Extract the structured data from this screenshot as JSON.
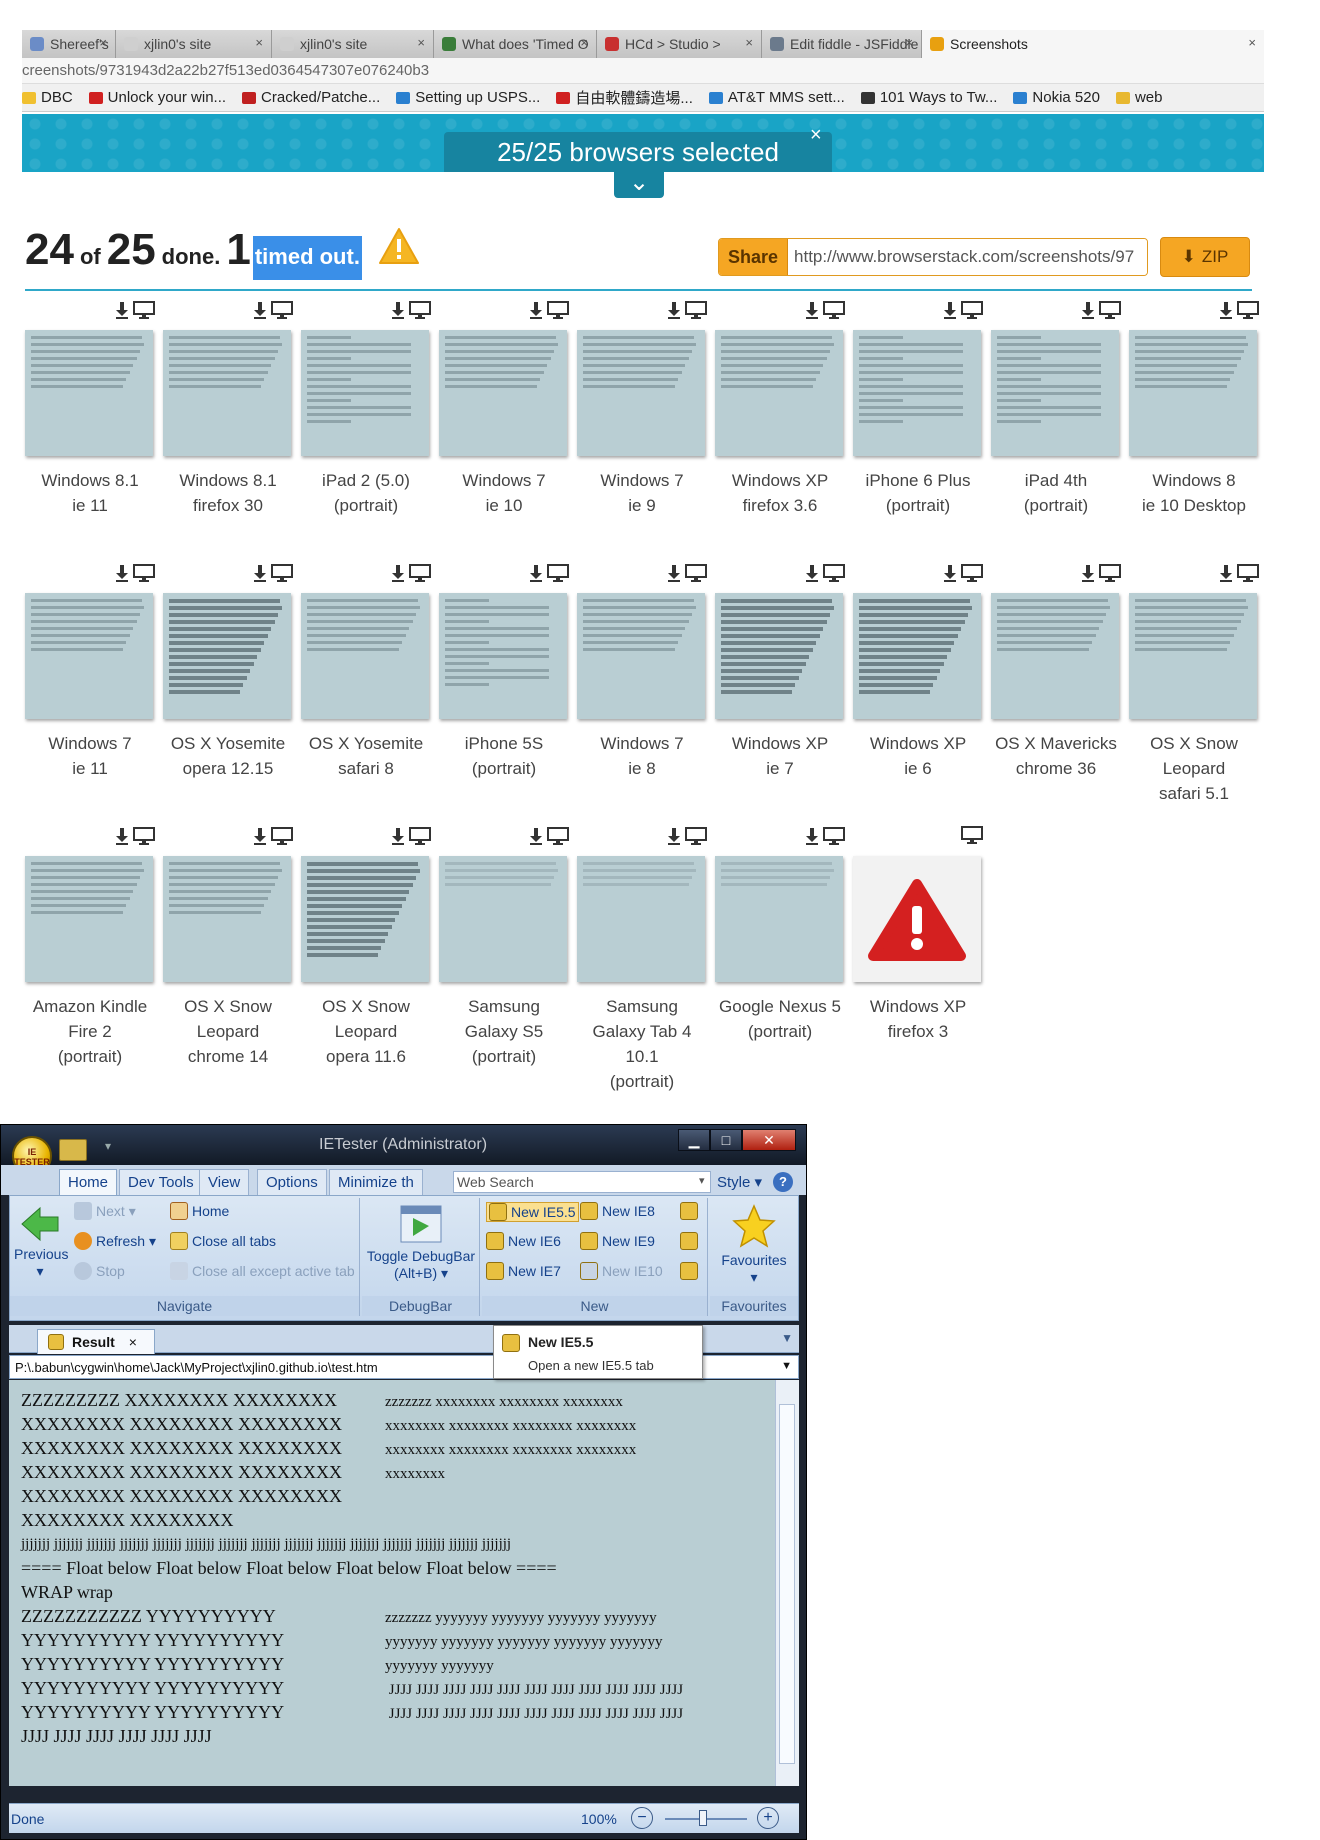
{
  "browser": {
    "tabs": [
      {
        "label": "Shereef's",
        "color": "#6b8cc7"
      },
      {
        "label": "xjlin0's site",
        "color": "#cfcfcf"
      },
      {
        "label": "xjlin0's site",
        "color": "#cfcfcf"
      },
      {
        "label": "What does 'Timed O",
        "color": "#3a7d3a"
      },
      {
        "label": "HCd > Studio >",
        "color": "#c83030"
      },
      {
        "label": "Edit fiddle - JSFiddle",
        "color": "#6b7a8c"
      },
      {
        "label": "Screenshots",
        "color": "#e8a010"
      }
    ],
    "close_glyph": "×",
    "url": "creenshots/9731943d2a22b27f513ed0364547307e076240b3",
    "bookmarks": [
      {
        "label": "DBC",
        "color": "#f0c030"
      },
      {
        "label": "Unlock your win...",
        "color": "#d02020"
      },
      {
        "label": "Cracked/Patche...",
        "color": "#c02020"
      },
      {
        "label": "Setting up USPS...",
        "color": "#2a80d0"
      },
      {
        "label": "自由軟體鑄造場...",
        "color": "#d02020"
      },
      {
        "label": "AT&T MMS sett...",
        "color": "#2a80d0"
      },
      {
        "label": "101 Ways to Tw...",
        "color": "#333333"
      },
      {
        "label": "Nokia 520",
        "color": "#2a80d0"
      },
      {
        "label": "web",
        "color": "#e8b830"
      }
    ]
  },
  "banner": {
    "title": "25/25 browsers selected",
    "close_glyph": "×",
    "expand_glyph": "⌄"
  },
  "status": {
    "done_count": "24",
    "of_word": "of",
    "total_count": "25",
    "done_word": "done.",
    "timeout_count": "1",
    "timeout_word": "timed out."
  },
  "share": {
    "button": "Share",
    "url": "http://www.browserstack.com/screenshots/97",
    "zip": "ZIP",
    "zip_glyph": "⬇"
  },
  "screens": [
    {
      "label": [
        "Windows 8.1",
        "ie 11"
      ],
      "style": "text"
    },
    {
      "label": [
        "Windows 8.1",
        "firefox 30"
      ],
      "style": "text"
    },
    {
      "label": [
        "iPad 2 (5.0)",
        "(portrait)"
      ],
      "style": "mobile"
    },
    {
      "label": [
        "Windows 7",
        "ie 10"
      ],
      "style": "text"
    },
    {
      "label": [
        "Windows 7",
        "ie 9"
      ],
      "style": "text"
    },
    {
      "label": [
        "Windows XP",
        "firefox 3.6"
      ],
      "style": "text"
    },
    {
      "label": [
        "iPhone 6 Plus",
        "(portrait)"
      ],
      "style": "mobile"
    },
    {
      "label": [
        "iPad 4th",
        "(portrait)"
      ],
      "style": "mobile"
    },
    {
      "label": [
        "Windows 8",
        "ie 10 Desktop"
      ],
      "style": "text"
    },
    {
      "label": [
        "Windows 7",
        "ie 11"
      ],
      "style": "text"
    },
    {
      "label": [
        "OS X Yosemite",
        "opera 12.15"
      ],
      "style": "dense"
    },
    {
      "label": [
        "OS X Yosemite",
        "safari 8"
      ],
      "style": "text"
    },
    {
      "label": [
        "iPhone 5S",
        "(portrait)"
      ],
      "style": "mobile"
    },
    {
      "label": [
        "Windows 7",
        "ie 8"
      ],
      "style": "text"
    },
    {
      "label": [
        "Windows XP",
        "ie 7"
      ],
      "style": "dense"
    },
    {
      "label": [
        "Windows XP",
        "ie 6"
      ],
      "style": "dense"
    },
    {
      "label": [
        "OS X Mavericks",
        "chrome 36"
      ],
      "style": "text"
    },
    {
      "label": [
        "OS X Snow",
        "Leopard",
        "safari 5.1"
      ],
      "style": "text"
    },
    {
      "label": [
        "Amazon Kindle",
        "Fire 2",
        "(portrait)"
      ],
      "style": "text"
    },
    {
      "label": [
        "OS X Snow",
        "Leopard",
        "chrome 14"
      ],
      "style": "text"
    },
    {
      "label": [
        "OS X Snow",
        "Leopard",
        "opera 11.6"
      ],
      "style": "dense"
    },
    {
      "label": [
        "Samsung",
        "Galaxy S5",
        "(portrait)"
      ],
      "style": "light"
    },
    {
      "label": [
        "Samsung",
        "Galaxy Tab 4",
        "10.1",
        "(portrait)"
      ],
      "style": "light"
    },
    {
      "label": [
        "Google Nexus 5",
        "(portrait)"
      ],
      "style": "light"
    },
    {
      "label": [
        "Windows XP",
        "firefox 3"
      ],
      "style": "error"
    }
  ],
  "ietester": {
    "title": "IETester (Administrator)",
    "orb_text": "IE TESTER",
    "ribbon_tabs": [
      "Home",
      "Dev Tools",
      "View",
      "Options",
      "Minimize th"
    ],
    "websearch_placeholder": "Web Search",
    "style_label": "Style",
    "help_glyph": "?",
    "navigate": {
      "previous": "Previous",
      "next": "Next",
      "refresh": "Refresh",
      "stop": "Stop",
      "home": "Home",
      "close_all": "Close all tabs",
      "close_except": "Close all except active tab",
      "group": "Navigate"
    },
    "debugbar": {
      "toggle_line1": "Toggle DebugBar",
      "toggle_line2": "(Alt+B)",
      "group": "DebugBar"
    },
    "new_group": {
      "items": [
        "New IE5.5",
        "New IE6",
        "New IE7",
        "New IE8",
        "New IE9",
        "New IE10"
      ],
      "group": "New"
    },
    "favourites": {
      "label": "Favourites",
      "group": "Favourites"
    },
    "result_tab": "Result",
    "result_close": "×",
    "popup_title": "New IE5.5",
    "popup_desc": "Open a new IE5.5 tab",
    "address": "P:\\.babun\\cygwin\\home\\Jack\\MyProject\\xjlin0.github.io\\test.htm",
    "content_left": [
      "ZZZZZZZZZ XXXXXXXX XXXXXXXX",
      "XXXXXXXX XXXXXXXX XXXXXXXX",
      "XXXXXXXX XXXXXXXX XXXXXXXX",
      "XXXXXXXX XXXXXXXX XXXXXXXX",
      "XXXXXXXX XXXXXXXX XXXXXXXX",
      "XXXXXXXX XXXXXXXX",
      "jjjjjjj jjjjjjj jjjjjjj jjjjjjj jjjjjjj jjjjjjj jjjjjjj jjjjjjj jjjjjjj jjjjjjj jjjjjjj jjjjjjj jjjjjjj jjjjjjj jjjjjjj",
      "==== Float below Float below Float below Float below Float below ====",
      "WRAP wrap",
      "ZZZZZZZZZZZ YYYYYYYYYY",
      "YYYYYYYYYY YYYYYYYYYY",
      "YYYYYYYYYY YYYYYYYYYY",
      "YYYYYYYYYY YYYYYYYYYY",
      "YYYYYYYYYY YYYYYYYYYY",
      "JJJJ JJJJ JJJJ JJJJ JJJJ JJJJ"
    ],
    "content_right_top": [
      "zzzzzzz xxxxxxxx xxxxxxxx xxxxxxxx",
      "xxxxxxxx xxxxxxxx xxxxxxxx xxxxxxxx",
      "xxxxxxxx xxxxxxxx xxxxxxxx xxxxxxxx",
      "xxxxxxxx"
    ],
    "content_right_bottom": [
      "zzzzzzz yyyyyyy yyyyyyy yyyyyyy yyyyyyy",
      "yyyyyyy yyyyyyy yyyyyyy yyyyyyy yyyyyyy",
      "yyyyyyy yyyyyyy",
      " JJJJ JJJJ JJJJ JJJJ JJJJ JJJJ JJJJ JJJJ JJJJ JJJJ JJJJ",
      " JJJJ JJJJ JJJJ JJJJ JJJJ JJJJ JJJJ JJJJ JJJJ JJJJ JJJJ"
    ],
    "status_text": "Done",
    "zoom": "100%",
    "zoom_minus": "−",
    "zoom_plus": "+"
  }
}
